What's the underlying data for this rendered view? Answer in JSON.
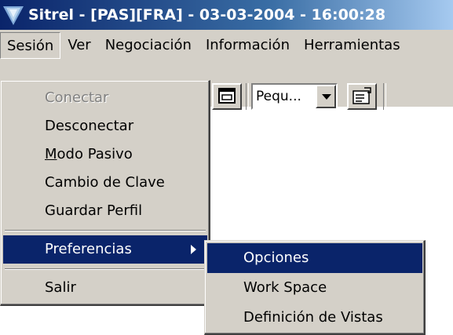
{
  "window": {
    "title": "Sitrel - [PAS][FRA] - 03-03-2004 - 16:00:28"
  },
  "menubar": {
    "items": [
      "Sesión",
      "Ver",
      "Negociación",
      "Información",
      "Herramientas"
    ]
  },
  "toolbar": {
    "font_size_value": "Pequ..."
  },
  "session_menu": {
    "items": [
      {
        "label": "Conectar",
        "state": "disabled"
      },
      {
        "label": "Desconectar"
      },
      {
        "label_mnemonic": "M",
        "label_rest": "odo Pasivo"
      },
      {
        "label": "Cambio de Clave"
      },
      {
        "label": "Guardar Perfil"
      },
      {
        "label": "Preferencias",
        "state": "selected",
        "has_submenu": true
      },
      {
        "label": "Salir"
      }
    ]
  },
  "preferences_submenu": {
    "items": [
      {
        "label": "Opciones",
        "state": "selected"
      },
      {
        "label": "Work Space"
      },
      {
        "label": "Definición de Vistas"
      }
    ]
  },
  "colors": {
    "titlebar_start": "#0a246a",
    "titlebar_end": "#a6caf0",
    "highlight": "#0a246a",
    "face": "#d4d0c8"
  }
}
